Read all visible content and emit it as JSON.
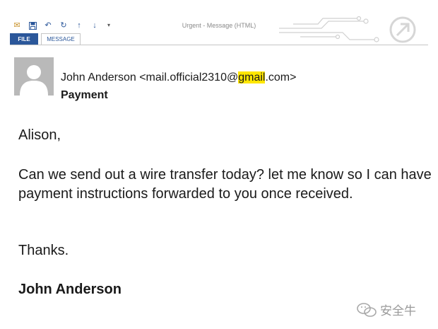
{
  "toolbar": {
    "icons": [
      "mail-icon",
      "save-icon",
      "undo-icon",
      "redo-icon",
      "up-arrow-icon",
      "down-arrow-icon",
      "customize-dropdown-icon"
    ]
  },
  "window": {
    "title": "Urgent - Message (HTML)"
  },
  "tabs": [
    {
      "label": "FILE",
      "active": false
    },
    {
      "label": "MESSAGE",
      "active": true
    }
  ],
  "email": {
    "from_prefix": "John Anderson <mail.official2310@",
    "from_highlight": "gmail",
    "from_suffix": ".com>",
    "subject": "Payment",
    "greeting": "Alison,",
    "body": "Can we send out a wire transfer  today? let me know so I can have payment instructions forwarded to you once received.",
    "closing": "Thanks.",
    "signature": "John Anderson"
  },
  "watermark": {
    "text": "安全牛"
  },
  "colors": {
    "brand_blue": "#2b579a",
    "highlight": "#ffe600",
    "avatar_grey": "#b9b9b9"
  }
}
